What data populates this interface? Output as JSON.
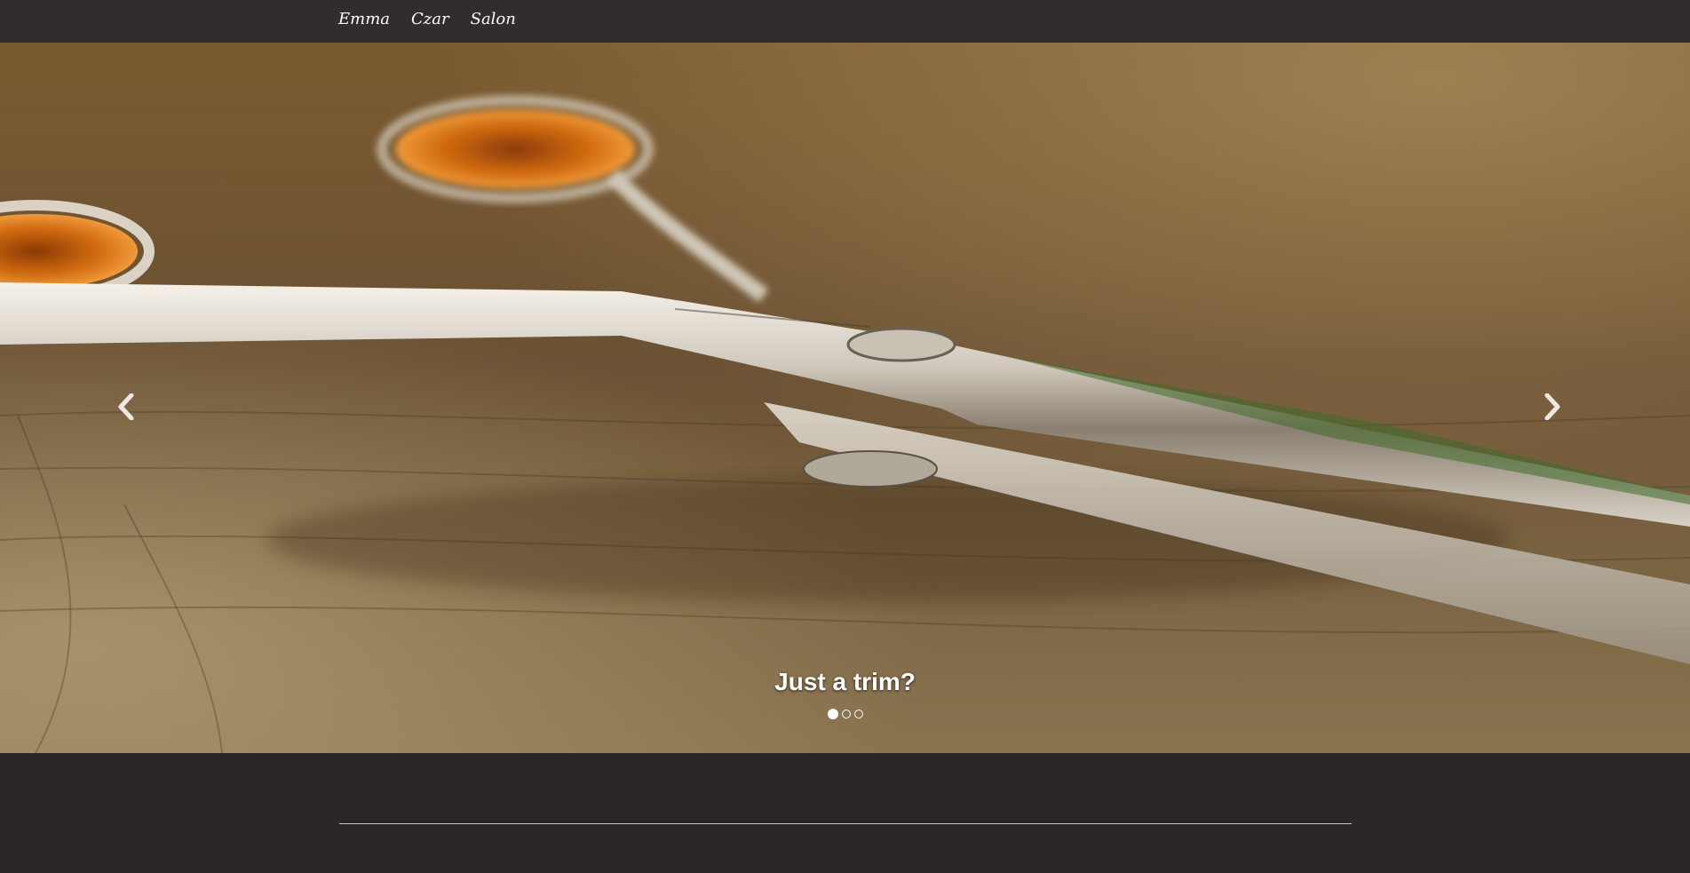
{
  "nav": {
    "links": [
      "Emma",
      "Czar",
      "Salon"
    ]
  },
  "carousel": {
    "caption": "Just a trim?",
    "slide_count": 3,
    "active_slide": 1,
    "prev_icon": "chevron-left-icon",
    "next_icon": "chevron-right-icon",
    "image_subject": "scissors-photo"
  },
  "colors": {
    "navbar": "#322c2e",
    "page_background": "#2b2527",
    "text": "#ffffff"
  }
}
